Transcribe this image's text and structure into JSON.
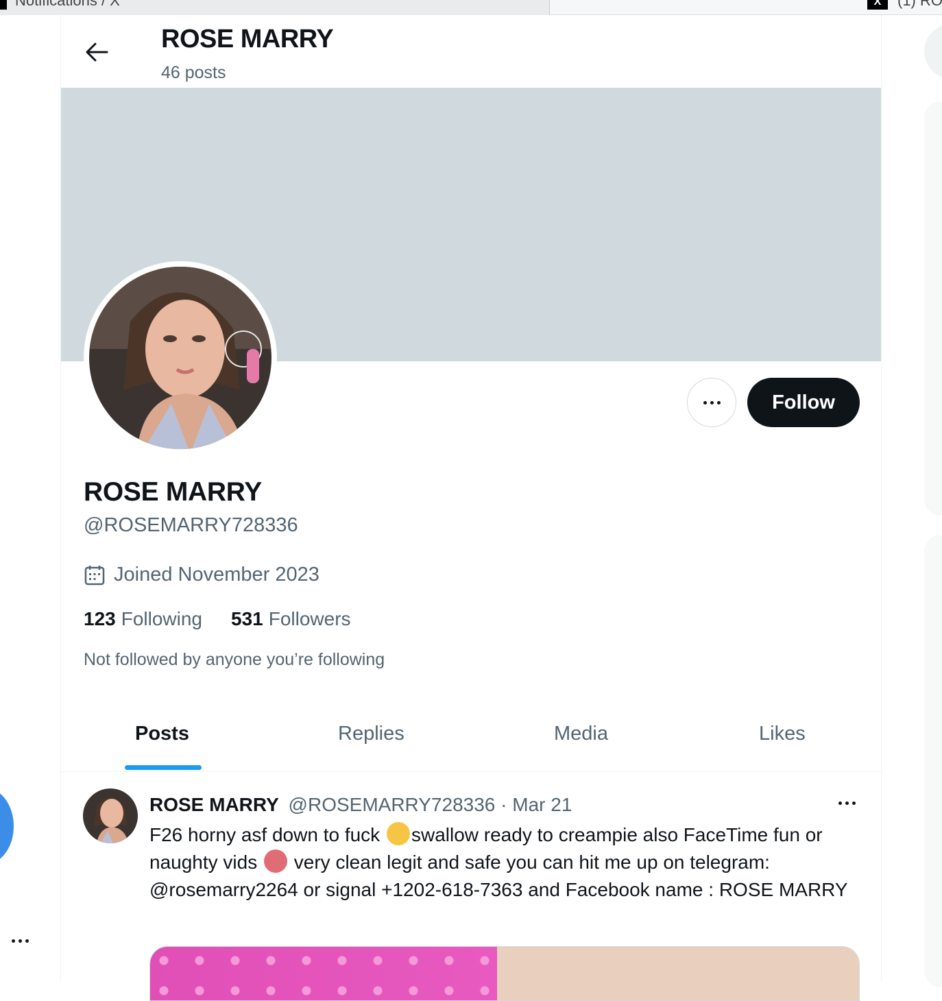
{
  "browser": {
    "tab_left_title": "Notifications / X",
    "tab_right_title": "(1) RO",
    "x_logo": "X"
  },
  "header": {
    "name": "ROSE MARRY",
    "posts_count": "46 posts"
  },
  "profile": {
    "name": "ROSE MARRY",
    "handle": "@ROSEMARRY728336",
    "joined": "Joined November 2023",
    "following_count": "123",
    "following_label": "Following",
    "followers_count": "531",
    "followers_label": "Followers",
    "not_followed": "Not followed by anyone you’re following",
    "follow_button": "Follow"
  },
  "tabs": [
    {
      "label": "Posts",
      "active": true
    },
    {
      "label": "Replies",
      "active": false
    },
    {
      "label": "Media",
      "active": false
    },
    {
      "label": "Likes",
      "active": false
    }
  ],
  "post": {
    "author": "ROSE MARRY",
    "handle": "@ROSEMARRY728336",
    "separator": "·",
    "date": "Mar 21",
    "text_part1": "F26 horny asf down to fuck ",
    "text_part2": "swallow ready to creampie also FaceTime fun or naughty vids ",
    "text_part3": " very clean legit and safe you can hit me up on telegram: @rosemarry2264  or signal +1202-618-7363 and Facebook name : ROSE MARRY"
  },
  "icons": {
    "back": "arrow-left-icon",
    "more": "more-horizontal-icon",
    "calendar": "calendar-icon",
    "emoji1": "kissing-face-emoji",
    "emoji2": "hot-face-emoji"
  },
  "colors": {
    "accent": "#1d9bf0",
    "text_primary": "#0f1419",
    "text_secondary": "#536471",
    "banner": "#cfd9de",
    "follow_bg": "#0f1419"
  }
}
